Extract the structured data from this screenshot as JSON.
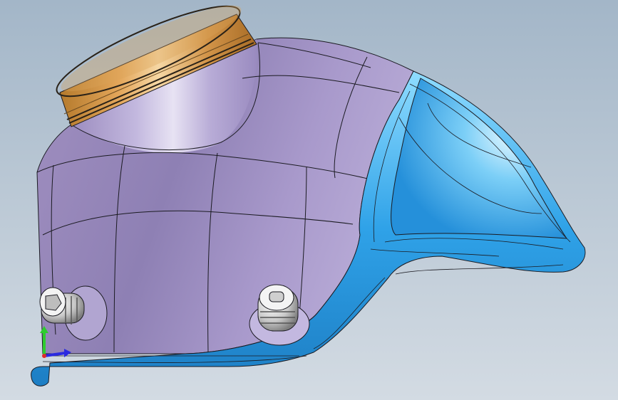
{
  "viewport": {
    "background_top": "#a3b6c8",
    "background_bottom": "#d3dbe3"
  },
  "model": {
    "body_color": "#a596c6",
    "body_highlight": "#e8e2f4",
    "flange_color": "#2f9fe6",
    "flange_highlight": "#b8ecff",
    "cap_color": "#c98a38",
    "cap_highlight": "#f2c988",
    "fitting_color": "#dcdcdc"
  },
  "triad": {
    "axes": [
      {
        "name": "y-axis",
        "color": "#2ecc2e"
      },
      {
        "name": "x-axis",
        "color": "#2a2ae0"
      },
      {
        "name": "z-axis",
        "color": "#e02a2a"
      }
    ]
  }
}
